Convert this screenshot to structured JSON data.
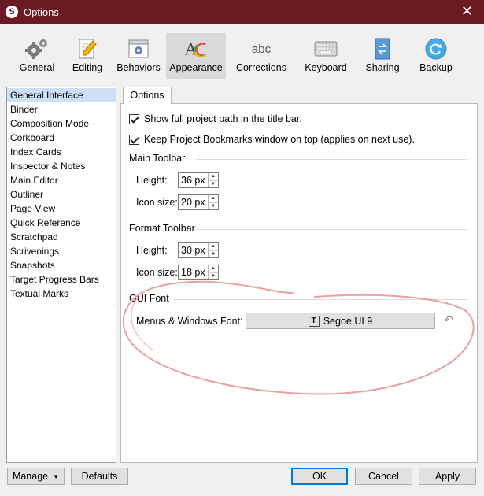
{
  "window": {
    "title": "Options",
    "app_icon_letter": "S",
    "close_glyph": "✕"
  },
  "toolbar": {
    "items": [
      {
        "label": "General",
        "icon": "gears-icon"
      },
      {
        "label": "Editing",
        "icon": "pencil-document-icon"
      },
      {
        "label": "Behaviors",
        "icon": "window-gear-icon"
      },
      {
        "label": "Appearance",
        "icon": "appearance-ac-icon",
        "active": true
      },
      {
        "label": "Corrections",
        "icon": "abc-icon"
      },
      {
        "label": "Keyboard",
        "icon": "keyboard-icon"
      },
      {
        "label": "Sharing",
        "icon": "sync-document-icon"
      },
      {
        "label": "Backup",
        "icon": "backup-circle-icon"
      }
    ],
    "icon_text": {
      "corrections": "abc"
    }
  },
  "sidebar": {
    "items": [
      {
        "label": "General Interface",
        "selected": true
      },
      {
        "label": "Binder"
      },
      {
        "label": "Composition Mode"
      },
      {
        "label": "Corkboard"
      },
      {
        "label": "Index Cards"
      },
      {
        "label": "Inspector & Notes"
      },
      {
        "label": "Main Editor"
      },
      {
        "label": "Outliner"
      },
      {
        "label": "Page View"
      },
      {
        "label": "Quick Reference"
      },
      {
        "label": "Scratchpad"
      },
      {
        "label": "Scrivenings"
      },
      {
        "label": "Snapshots"
      },
      {
        "label": "Target Progress Bars"
      },
      {
        "label": "Textual Marks"
      }
    ]
  },
  "tabs": {
    "options": "Options"
  },
  "options": {
    "show_path": {
      "label": "Show full project path in the title bar.",
      "checked": true
    },
    "keep_bookmarks": {
      "label": "Keep Project Bookmarks window on top (applies on next use).",
      "checked": true
    }
  },
  "main_toolbar": {
    "title": "Main Toolbar",
    "height_label": "Height:",
    "height_value": "36 px",
    "icon_size_label": "Icon size:",
    "icon_size_value": "20 px"
  },
  "format_toolbar": {
    "title": "Format Toolbar",
    "height_label": "Height:",
    "height_value": "30 px",
    "icon_size_label": "Icon size:",
    "icon_size_value": "18 px"
  },
  "gui_font": {
    "title": "GUI Font",
    "font_label": "Menus & Windows Font:",
    "font_value": "Segoe UI 9",
    "font_icon_glyph": "T",
    "reset_glyph": "↶"
  },
  "footer": {
    "manage": "Manage",
    "defaults": "Defaults",
    "ok": "OK",
    "cancel": "Cancel",
    "apply": "Apply",
    "dropdown_glyph": "▼"
  },
  "glyphs": {
    "up": "▲",
    "down": "▼"
  },
  "colors": {
    "titlebar": "#6b1a22",
    "annotation": "#e8a0a0",
    "selection": "#cde0f5",
    "default_button_border": "#0078d7"
  }
}
